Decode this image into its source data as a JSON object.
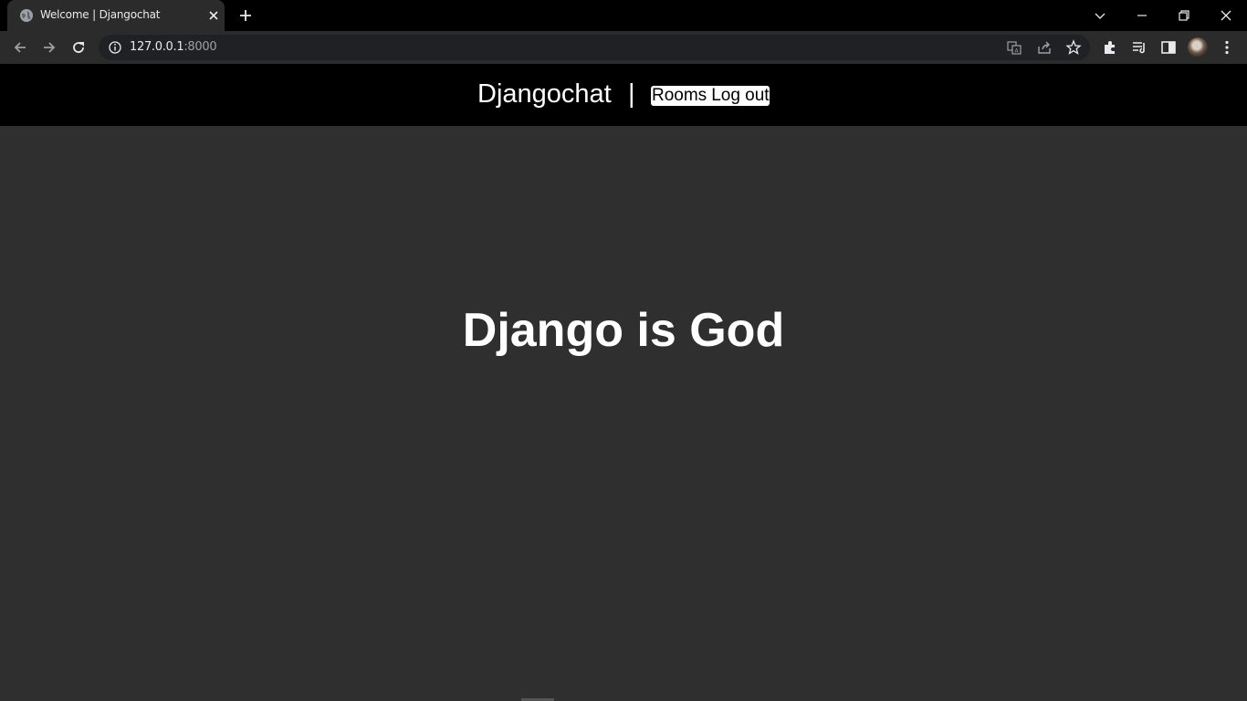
{
  "browser": {
    "tab_title": "Welcome | Djangochat",
    "url_host": "127.0.0.1",
    "url_port": ":8000"
  },
  "site": {
    "brand": "Djangochat",
    "separator": "|",
    "nav": {
      "rooms": "Rooms",
      "logout": "Log out"
    },
    "hero_title": "Django is God"
  },
  "icons": {
    "tab_favicon": "globe-icon",
    "tab_close": "close-icon",
    "new_tab": "plus-icon",
    "back": "arrow-left-icon",
    "forward": "arrow-right-icon",
    "reload": "reload-icon",
    "site_info": "info-icon",
    "translate": "translate-icon",
    "share": "share-icon",
    "bookmark": "star-icon",
    "extensions": "puzzle-icon",
    "media": "media-queue-icon",
    "side_panel": "side-panel-icon",
    "menu": "kebab-menu-icon"
  },
  "colors": {
    "chrome_dark": "#000000",
    "toolbar": "#2b2b2b",
    "page_bg": "#2f2f2f",
    "nav_bg": "#000000",
    "text": "#ffffff"
  }
}
